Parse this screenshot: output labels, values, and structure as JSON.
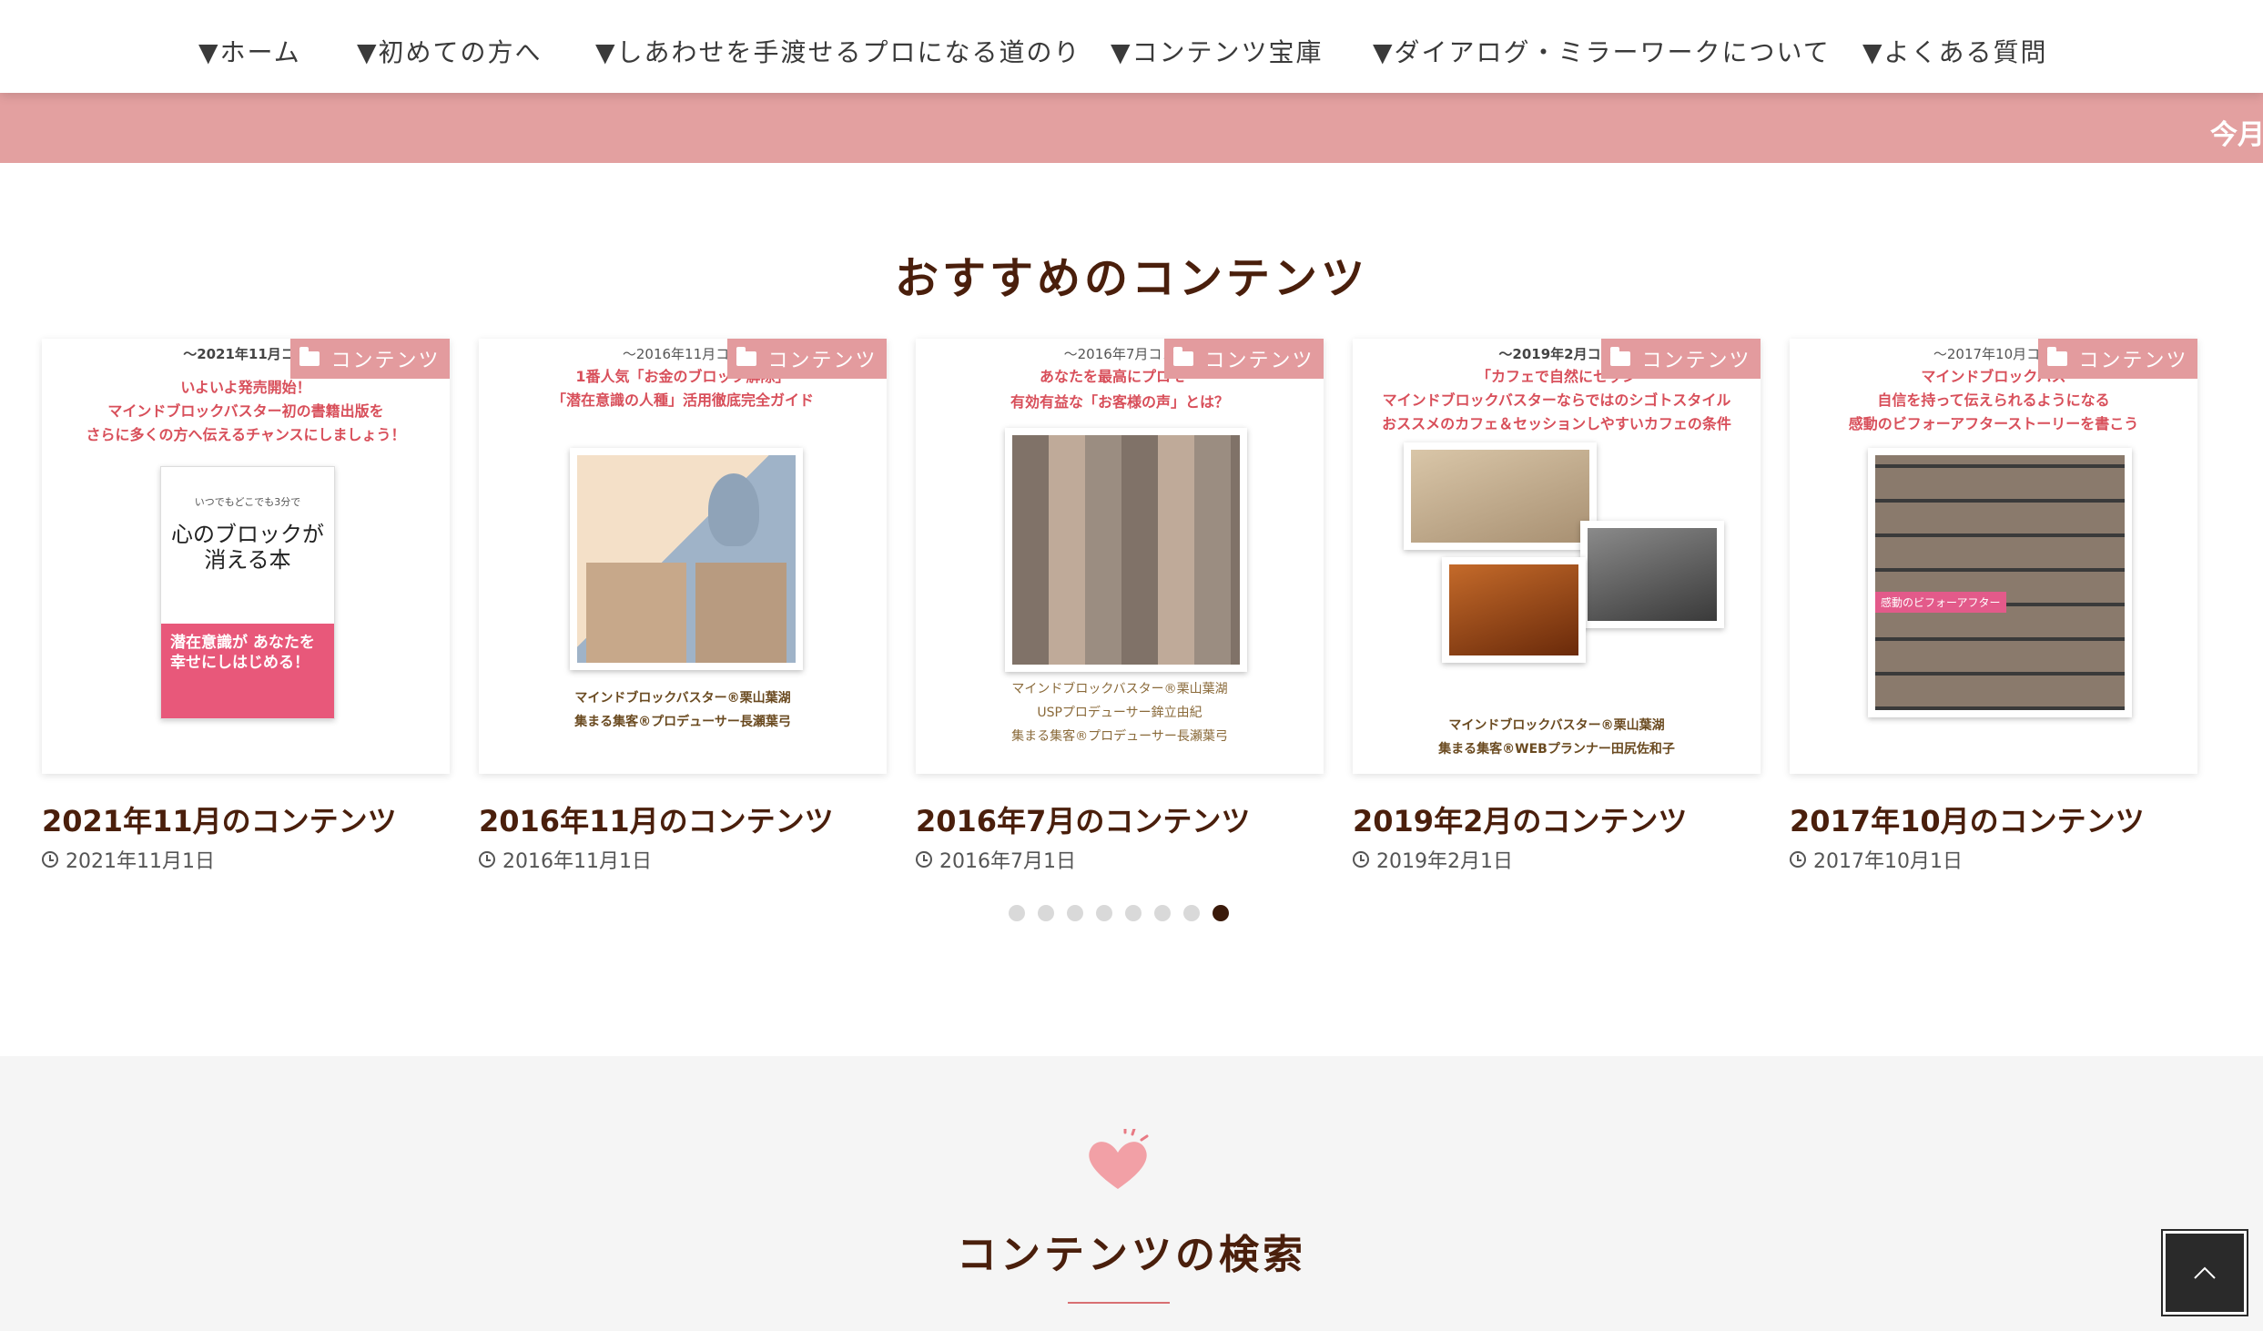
{
  "nav": {
    "items": [
      "▼ホーム",
      "▼初めての方へ",
      "▼しあわせを手渡せるプロになる道のり",
      "▼コンテンツ宝庫",
      "▼ダイアログ・ミラーワークについて",
      "▼よくある質問"
    ]
  },
  "ticker": {
    "text": "今月"
  },
  "recommended": {
    "title": "おすすめのコンテンツ",
    "category_label": "コンテンツ",
    "cards": [
      {
        "title": "2021年11月のコンテンツ",
        "date": "2021年11月1日",
        "thumb": {
          "head": "〜2021年11月コン",
          "lines": [
            "いよいよ発売開始！",
            "マインドブロックバスター初の書籍出版を",
            "さらに多くの方へ伝えるチャンスにしましょう！"
          ],
          "book_title": "心のブロックが消える本",
          "book_sub": "いつでもどこでも3分で",
          "book_band": "潜在意識が あなたを 幸せにしはじめる！"
        }
      },
      {
        "title": "2016年11月のコンテンツ",
        "date": "2016年11月1日",
        "thumb": {
          "head": "〜2016年11月コン",
          "lines": [
            "1番人気「お金のブロック解除」",
            "「潜在意識の人種」活用徹底完全ガイド"
          ],
          "foot": [
            "マインドブロックバスター®栗山葉湖",
            "集まる集客®プロデューサー長瀬葉弓"
          ]
        }
      },
      {
        "title": "2016年7月のコンテンツ",
        "date": "2016年7月1日",
        "thumb": {
          "head": "〜2016年7月コン",
          "lines": [
            "あなたを最高にプロモー",
            "有効有益な「お客様の声」とは？"
          ],
          "foot": [
            "マインドブロックバスター®栗山葉湖",
            "USPプロデューサー鉾立由紀",
            "集まる集客®プロデューサー長瀬葉弓"
          ]
        }
      },
      {
        "title": "2019年2月のコンテンツ",
        "date": "2019年2月1日",
        "thumb": {
          "head": "〜2019年2月コン",
          "lines": [
            "「カフェで自然にセッシ",
            "マインドブロックバスターならではのシゴトスタイル",
            "おススメのカフェ＆セッションしやすいカフェの条件"
          ],
          "foot": [
            "マインドブロックバスター®栗山葉湖",
            "集まる集客®WEBプランナー田尻佐和子"
          ]
        }
      },
      {
        "title": "2017年10月のコンテンツ",
        "date": "2017年10月1日",
        "thumb": {
          "head": "〜2017年10月コン",
          "lines": [
            "マインドブロックバス",
            "自信を持って伝えられるようになる",
            "感動のビフォーアフターストーリーを書こう"
          ],
          "caption": "感動のビフォーアフター"
        }
      }
    ],
    "carousel": {
      "dot_count": 8,
      "active_index": 7
    }
  },
  "search": {
    "title": "コンテンツの検索"
  },
  "icons": {
    "folder": "folder-icon",
    "clock": "clock-icon",
    "heart": "heart-icon",
    "back_to_top": "chevron-up-icon"
  },
  "colors": {
    "ticker_bg": "#e3a0a0",
    "badge_bg": "#e39b9e",
    "title_brown": "#4a1f0c",
    "accent_pink": "#d84f5a"
  }
}
